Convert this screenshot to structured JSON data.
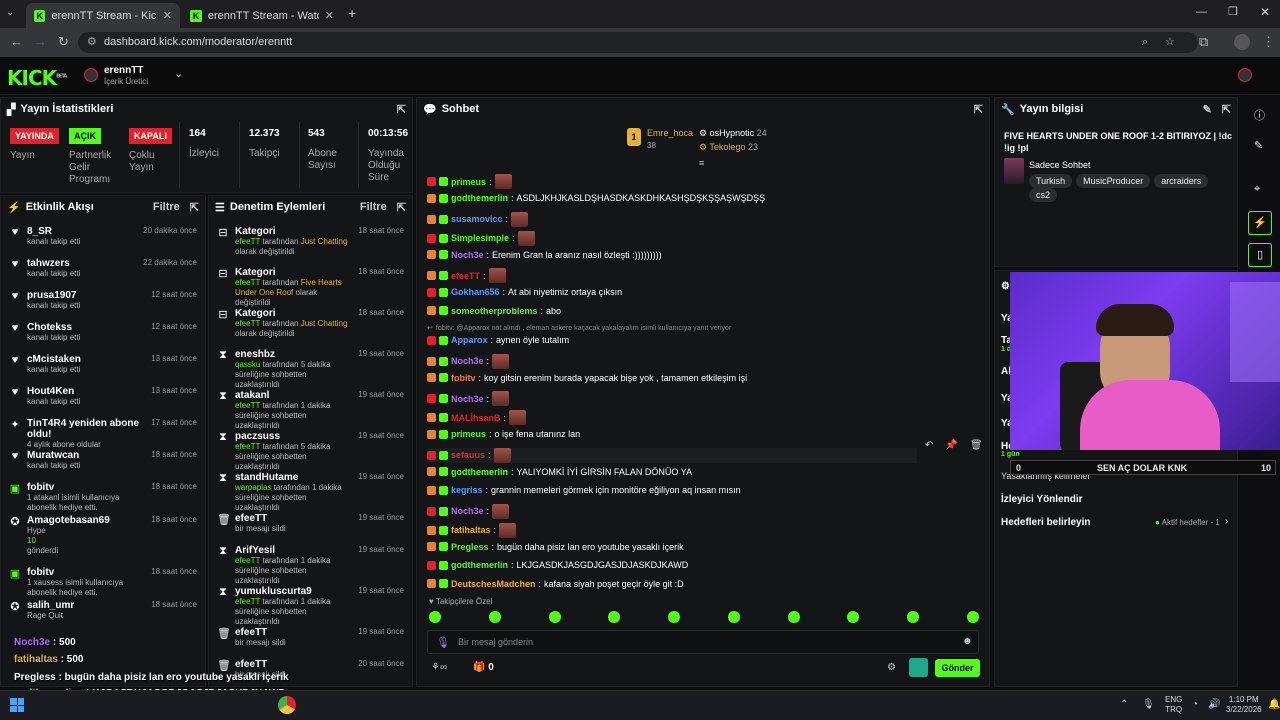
{
  "browser": {
    "tabs": [
      {
        "title": "erennTT Stream - Kick Dashbo"
      },
      {
        "title": "erennTT Stream - Watch Live o"
      }
    ],
    "url": "dashboard.kick.com/moderator/erenntt"
  },
  "header": {
    "channel": "erennTT",
    "role": "İçerik Üretici",
    "logo": "KICK",
    "logo_badge": "BETA"
  },
  "stats": {
    "title": "Yayın İstatistikleri",
    "items": [
      {
        "badge": "YAYINDA",
        "badge_color": "#e0212e",
        "label": "Yayın"
      },
      {
        "badge": "AÇIK",
        "badge_color": "#53fc18",
        "label": "Partnerlik Gelir Programı"
      },
      {
        "badge": "KAPALI",
        "badge_color": "#e0212e",
        "label": "Çoklu Yayın"
      },
      {
        "value": "164",
        "label": "İzleyici"
      },
      {
        "value": "12.373",
        "label": "Takipçi"
      },
      {
        "value": "543",
        "label": "Abone Sayısı"
      },
      {
        "value": "00:13:56",
        "label": "Yayında Olduğu Süre"
      }
    ]
  },
  "activity": {
    "title": "Etkinlik Akışı",
    "filter": "Filtre",
    "items": [
      {
        "icon": "heart",
        "name": "8_SR",
        "sub": "kanalı takip etti",
        "time": "20 dakika önce"
      },
      {
        "icon": "heart",
        "name": "tahwzers",
        "sub": "kanalı takip etti",
        "time": "22 dakika önce"
      },
      {
        "icon": "heart",
        "name": "prusa1907",
        "sub": "kanalı takip etti",
        "time": "12 saat önce"
      },
      {
        "icon": "heart",
        "name": "Chotekss",
        "sub": "kanalı takip etti",
        "time": "12 saat önce"
      },
      {
        "icon": "heart",
        "name": "cMcistaken",
        "sub": "kanalı takip etti",
        "time": "13 saat önce"
      },
      {
        "icon": "heart",
        "name": "Hout4Ken",
        "sub": "kanalı takip etti",
        "time": "13 saat önce"
      },
      {
        "icon": "star",
        "name": "TinT4R4 yeniden abone oldu!",
        "sub": "4 aylık abone oldular",
        "time": "17 saat önce"
      },
      {
        "icon": "heart",
        "name": "Muratwcan",
        "sub": "kanalı takip etti",
        "time": "18 saat önce"
      },
      {
        "icon": "gift",
        "name": "fobitv",
        "sub": "1 atakanl isimli kullanıcıya abonelik hediye etti.",
        "time": "18 saat önce"
      },
      {
        "icon": "kick",
        "name": "Amagotebasan69",
        "sub": "Hype",
        "sub2": "10",
        "sub3": "gönderdi",
        "time": "18 saat önce"
      },
      {
        "icon": "gift",
        "name": "fobitv",
        "sub": "1 xausess isimli kullanıcıya abonelik hediye etti.",
        "time": "18 saat önce"
      },
      {
        "icon": "kick",
        "name": "salih_umr",
        "sub": "Rage Quit",
        "time": "18 saat önce"
      }
    ]
  },
  "mod": {
    "title": "Denetim Eylemleri",
    "filter": "Filtre",
    "items": [
      {
        "icon": "category",
        "name": "Kategori",
        "actor": "efeeTT",
        "sub": "tarafından",
        "hl": "Just Chatting",
        "sub2": "olarak değiştirildi",
        "time": "18 saat önce"
      },
      {
        "icon": "category",
        "name": "Kategori",
        "actor": "efeeTT",
        "sub": "tarafından",
        "hl": "Five Hearts Under One Roof",
        "sub2": "olarak değiştirildi",
        "time": "18 saat önce"
      },
      {
        "icon": "category",
        "name": "Kategori",
        "actor": "efeeTT",
        "sub": "tarafından",
        "hl": "Just Chatting",
        "sub2": "olarak değiştirildi",
        "time": "18 saat önce"
      },
      {
        "icon": "timeout",
        "name": "eneshbz",
        "actor": "qassku",
        "sub": "tarafından 5 dakika süreliğine sohbetten uzaklaştırıldı",
        "time": "19 saat önce"
      },
      {
        "icon": "timeout",
        "name": "atakanl",
        "actor": "efeeTT",
        "sub": "tarafından 1 dakika süreliğine sohbetten uzaklaştırıldı",
        "time": "19 saat önce"
      },
      {
        "icon": "timeout",
        "name": "paczsuss",
        "actor": "efeeTT",
        "sub": "tarafından 5 dakika süreliğine sohbetten uzaklaştırıldı",
        "time": "19 saat önce"
      },
      {
        "icon": "timeout",
        "name": "standHutame",
        "actor": "warpaplas",
        "sub": "tarafından 1 dakika süreliğine sohbetten uzaklaştırıldı",
        "time": "19 saat önce"
      },
      {
        "icon": "trash",
        "name": "efeeTT",
        "sub": "bir mesajı sildi",
        "time": "19 saat önce"
      },
      {
        "icon": "timeout",
        "name": "ArifYesil",
        "actor": "efeeTT",
        "sub": "tarafından 1 dakika süreliğine sohbetten uzaklaştırıldı",
        "time": "19 saat önce"
      },
      {
        "icon": "timeout",
        "name": "yumukluscurta9",
        "actor": "efeeTT",
        "sub": "tarafından 1 dakika süreliğine sohbetten uzaklaştırıldı",
        "time": "19 saat önce"
      },
      {
        "icon": "trash",
        "name": "efeeTT",
        "sub": "bir mesajı sildi",
        "time": "19 saat önce"
      },
      {
        "icon": "trash",
        "name": "efeeTT",
        "sub": "bir mesajı sildi",
        "time": "20 saat önce"
      }
    ]
  },
  "chat": {
    "title": "Sohbet",
    "top": [
      {
        "name": "Emre_hoca",
        "value": "38"
      },
      {
        "name": "osHypnotic",
        "value": "24"
      },
      {
        "name": "Tekolego",
        "value": "23"
      }
    ],
    "messages": [
      {
        "user": "primeus",
        "color": "#53fc18",
        "text": "",
        "emote": true
      },
      {
        "user": "godthemerlin",
        "color": "#53fc18",
        "text": "ASDLJKHJKASLDŞHASDKASKDHKASHŞDŞKŞŞAŞWŞDŞŞ"
      },
      {
        "user": "susamovicc",
        "color": "#5b9cff",
        "text": "",
        "emote": true
      },
      {
        "user": "Simplesimple",
        "color": "#53fc18",
        "text": "",
        "emote": true
      },
      {
        "user": "Noch3e",
        "color": "#b36cf5",
        "text": "Erenim Gran la aranız nasıl özleşti :)))))))))"
      },
      {
        "user": "efeeTT",
        "color": "#e0212e",
        "text": "",
        "emote": true
      },
      {
        "user": "Gokhan656",
        "color": "#5b9cff",
        "text": "At abi niyetimiz ortaya çıksın"
      },
      {
        "user": "someotherproblems",
        "color": "#53fc18",
        "text": "abo"
      },
      {
        "reply": "fobitv: @Apparox not alındı , eleman askere kaçacak yakalayalım isimli kullanıcıya yanıt veriyor"
      },
      {
        "user": "Apparox",
        "color": "#5b9cff",
        "text": "aynen öyle tutalım"
      },
      {
        "user": "Noch3e",
        "color": "#b36cf5",
        "text": "",
        "emote": true
      },
      {
        "user": "fobitv",
        "color": "#e8813a",
        "text": "koy gitsin erenim burada yapacak bişe yok , tamamen etkileşim işi"
      },
      {
        "user": "Noch3e",
        "color": "#b36cf5",
        "text": "",
        "emote": true
      },
      {
        "user": "MALİhsanB",
        "color": "#e0212e",
        "text": "",
        "emote": true
      },
      {
        "user": "primeus",
        "color": "#53fc18",
        "text": "o işe fena utanınz lan"
      },
      {
        "user": "sefauus",
        "color": "#e0212e",
        "text": "",
        "emote": true,
        "hover": true
      },
      {
        "user": "godthemerlin",
        "color": "#53fc18",
        "text": "YALIYOMKİ İYİ GİRSİN FALAN DÖNÜO YA"
      },
      {
        "user": "kegriss",
        "color": "#5b9cff",
        "text": "grannin memeleri görmek için monitöre eğiliyon aq insan mısın"
      },
      {
        "user": "Noch3e",
        "color": "#b36cf5",
        "text": "",
        "emote": true
      },
      {
        "user": "fatihaltas",
        "color": "#e8b13a",
        "text": "",
        "emote": true
      },
      {
        "user": "Pregless",
        "color": "#53fc18",
        "text": "bugün daha pisiz lan ero youtube yasaklı içerik"
      },
      {
        "user": "godthemerlin",
        "color": "#53fc18",
        "text": "LKJGASDKJASGDJGASJDJASKDJKAWD"
      },
      {
        "user": "DeutschesMadchen",
        "color": "#e8b13a",
        "text": "kafana siyah poşet geçir öyle git :D"
      }
    ],
    "followers_only": "Takipçilere Özel",
    "placeholder": "Bir mesaj gönderin",
    "send": "Gönder",
    "viewers": "0"
  },
  "info": {
    "title": "Yayın bilgisi",
    "stream_title": "FIVE HEARTS UNDER ONE ROOF 1-2 BITIRIYOZ | !dc !ig !pl",
    "chat_mode": "Sadece Sohbet",
    "tags": [
      "Turkish",
      "MusicProducer",
      "arcraiders",
      "cs2"
    ]
  },
  "settings": {
    "rows": [
      "Yasaklanmış kelimeler",
      "İzleyici Yönlendir",
      "Hedefleri belirleyin"
    ],
    "goals_status": "Aktif hedefler - 1",
    "fragments": [
      "Ya",
      "Tal",
      "1 dk",
      "Ab",
      "Ya",
      "Ya",
      "He",
      "1 gün"
    ]
  },
  "overlay": {
    "left": "0",
    "text": "SEN AÇ DOLAR KNK",
    "right": "10"
  },
  "bottom_overlay": [
    {
      "user": "Noch3e",
      "text": "500"
    },
    {
      "user": "fatihaltas",
      "text": "500"
    },
    {
      "user": "Pregless",
      "text": "bugün daha pisiz lan ero youtube yasaklı içerik"
    },
    {
      "user": "godthemerlin",
      "text": "LKJGASDKJASGDJGASJDJASKDJKAWD"
    },
    {
      "user": "DeutschesMadchen",
      "text": "kafana siyah poşet geçir öyle git :D"
    }
  ],
  "taskbar": {
    "lang1": "ENG",
    "lang2": "TRQ",
    "time": "1:10 PM",
    "date": "3/22/2026"
  },
  "colors": {
    "accent": "#53fc18",
    "bg": "#0e0e10",
    "panel": "#141517"
  }
}
